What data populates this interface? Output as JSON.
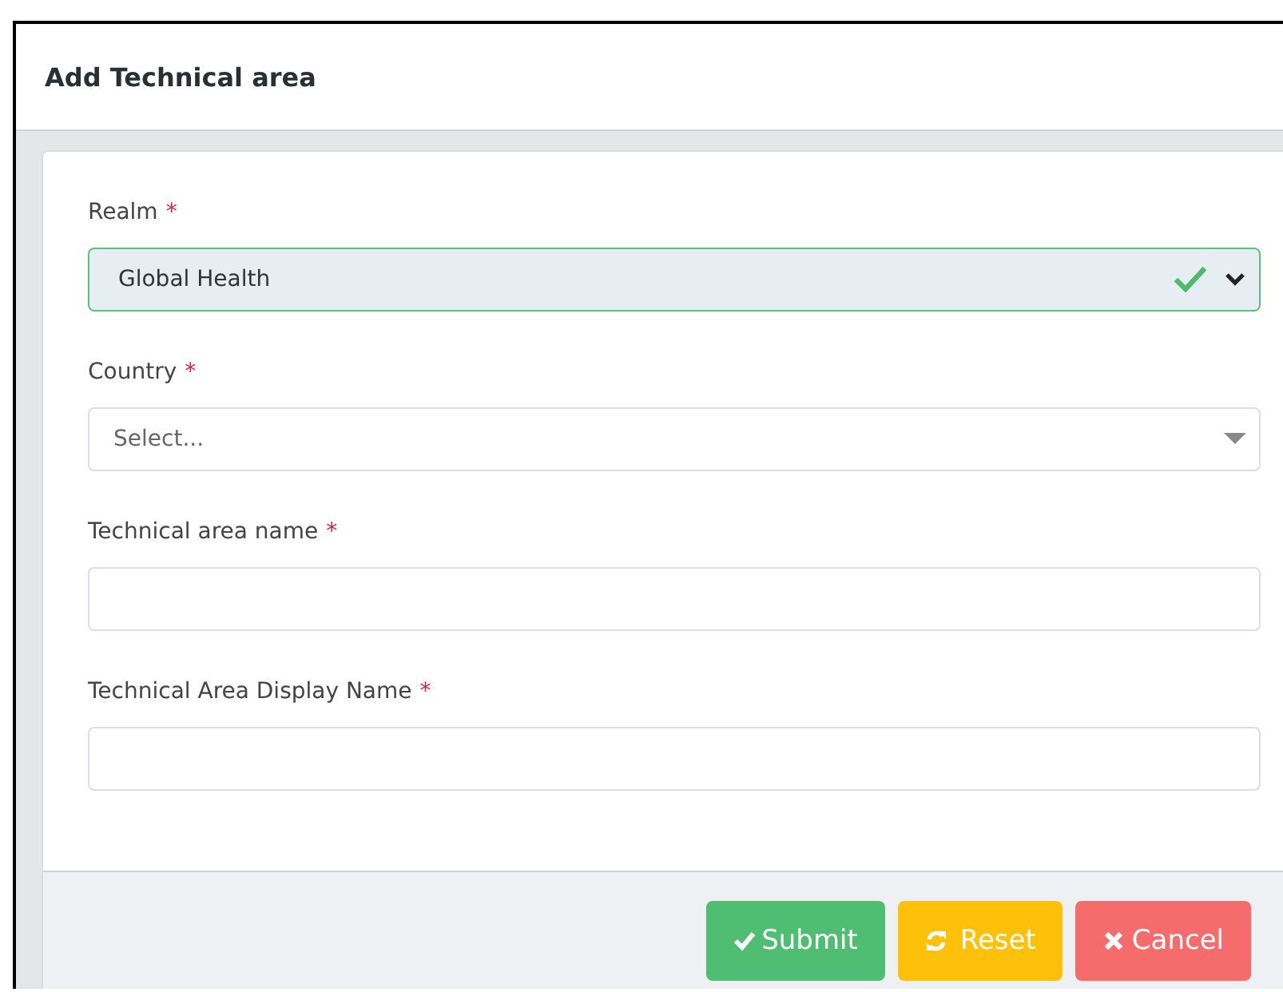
{
  "dialog": {
    "title": "Add Technical area"
  },
  "fields": [
    {
      "kind": "select",
      "label": "Realm",
      "required_mark": "*",
      "value": "Global Health",
      "valid": true
    },
    {
      "kind": "combo",
      "label": "Country",
      "required_mark": "*",
      "placeholder": "Select...",
      "valid": false
    },
    {
      "kind": "text",
      "label": "Technical area name",
      "required_mark": "*",
      "valid": false
    },
    {
      "kind": "text",
      "label": "Technical Area Display Name",
      "required_mark": "*",
      "valid": false
    }
  ],
  "buttons": [
    {
      "kind": "submit",
      "label": "Submit"
    },
    {
      "kind": "reset",
      "label": "Reset"
    },
    {
      "kind": "cancel",
      "label": "Cancel"
    }
  ]
}
